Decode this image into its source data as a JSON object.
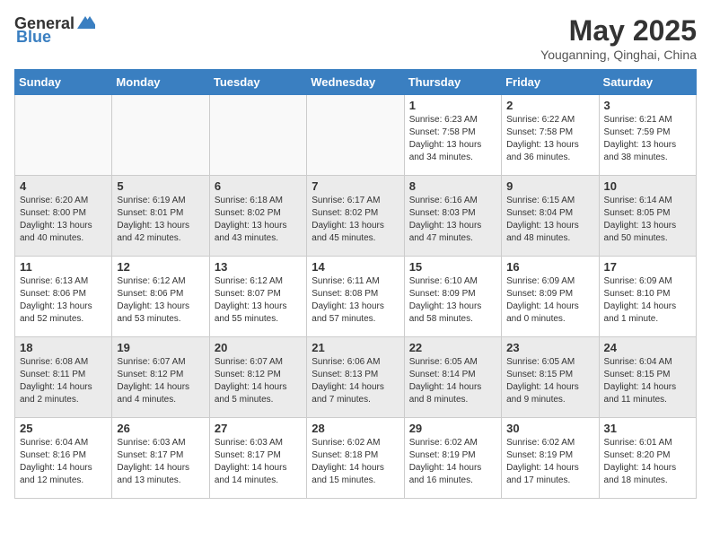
{
  "header": {
    "logo_general": "General",
    "logo_blue": "Blue",
    "month_year": "May 2025",
    "location": "Youganning, Qinghai, China"
  },
  "weekdays": [
    "Sunday",
    "Monday",
    "Tuesday",
    "Wednesday",
    "Thursday",
    "Friday",
    "Saturday"
  ],
  "weeks": [
    [
      {
        "day": "",
        "empty": true
      },
      {
        "day": "",
        "empty": true
      },
      {
        "day": "",
        "empty": true
      },
      {
        "day": "",
        "empty": true
      },
      {
        "day": "1",
        "sunrise": "6:23 AM",
        "sunset": "7:58 PM",
        "daylight": "13 hours and 34 minutes."
      },
      {
        "day": "2",
        "sunrise": "6:22 AM",
        "sunset": "7:58 PM",
        "daylight": "13 hours and 36 minutes."
      },
      {
        "day": "3",
        "sunrise": "6:21 AM",
        "sunset": "7:59 PM",
        "daylight": "13 hours and 38 minutes."
      }
    ],
    [
      {
        "day": "4",
        "sunrise": "6:20 AM",
        "sunset": "8:00 PM",
        "daylight": "13 hours and 40 minutes."
      },
      {
        "day": "5",
        "sunrise": "6:19 AM",
        "sunset": "8:01 PM",
        "daylight": "13 hours and 42 minutes."
      },
      {
        "day": "6",
        "sunrise": "6:18 AM",
        "sunset": "8:02 PM",
        "daylight": "13 hours and 43 minutes."
      },
      {
        "day": "7",
        "sunrise": "6:17 AM",
        "sunset": "8:02 PM",
        "daylight": "13 hours and 45 minutes."
      },
      {
        "day": "8",
        "sunrise": "6:16 AM",
        "sunset": "8:03 PM",
        "daylight": "13 hours and 47 minutes."
      },
      {
        "day": "9",
        "sunrise": "6:15 AM",
        "sunset": "8:04 PM",
        "daylight": "13 hours and 48 minutes."
      },
      {
        "day": "10",
        "sunrise": "6:14 AM",
        "sunset": "8:05 PM",
        "daylight": "13 hours and 50 minutes."
      }
    ],
    [
      {
        "day": "11",
        "sunrise": "6:13 AM",
        "sunset": "8:06 PM",
        "daylight": "13 hours and 52 minutes."
      },
      {
        "day": "12",
        "sunrise": "6:12 AM",
        "sunset": "8:06 PM",
        "daylight": "13 hours and 53 minutes."
      },
      {
        "day": "13",
        "sunrise": "6:12 AM",
        "sunset": "8:07 PM",
        "daylight": "13 hours and 55 minutes."
      },
      {
        "day": "14",
        "sunrise": "6:11 AM",
        "sunset": "8:08 PM",
        "daylight": "13 hours and 57 minutes."
      },
      {
        "day": "15",
        "sunrise": "6:10 AM",
        "sunset": "8:09 PM",
        "daylight": "13 hours and 58 minutes."
      },
      {
        "day": "16",
        "sunrise": "6:09 AM",
        "sunset": "8:09 PM",
        "daylight": "14 hours and 0 minutes."
      },
      {
        "day": "17",
        "sunrise": "6:09 AM",
        "sunset": "8:10 PM",
        "daylight": "14 hours and 1 minute."
      }
    ],
    [
      {
        "day": "18",
        "sunrise": "6:08 AM",
        "sunset": "8:11 PM",
        "daylight": "14 hours and 2 minutes."
      },
      {
        "day": "19",
        "sunrise": "6:07 AM",
        "sunset": "8:12 PM",
        "daylight": "14 hours and 4 minutes."
      },
      {
        "day": "20",
        "sunrise": "6:07 AM",
        "sunset": "8:12 PM",
        "daylight": "14 hours and 5 minutes."
      },
      {
        "day": "21",
        "sunrise": "6:06 AM",
        "sunset": "8:13 PM",
        "daylight": "14 hours and 7 minutes."
      },
      {
        "day": "22",
        "sunrise": "6:05 AM",
        "sunset": "8:14 PM",
        "daylight": "14 hours and 8 minutes."
      },
      {
        "day": "23",
        "sunrise": "6:05 AM",
        "sunset": "8:15 PM",
        "daylight": "14 hours and 9 minutes."
      },
      {
        "day": "24",
        "sunrise": "6:04 AM",
        "sunset": "8:15 PM",
        "daylight": "14 hours and 11 minutes."
      }
    ],
    [
      {
        "day": "25",
        "sunrise": "6:04 AM",
        "sunset": "8:16 PM",
        "daylight": "14 hours and 12 minutes."
      },
      {
        "day": "26",
        "sunrise": "6:03 AM",
        "sunset": "8:17 PM",
        "daylight": "14 hours and 13 minutes."
      },
      {
        "day": "27",
        "sunrise": "6:03 AM",
        "sunset": "8:17 PM",
        "daylight": "14 hours and 14 minutes."
      },
      {
        "day": "28",
        "sunrise": "6:02 AM",
        "sunset": "8:18 PM",
        "daylight": "14 hours and 15 minutes."
      },
      {
        "day": "29",
        "sunrise": "6:02 AM",
        "sunset": "8:19 PM",
        "daylight": "14 hours and 16 minutes."
      },
      {
        "day": "30",
        "sunrise": "6:02 AM",
        "sunset": "8:19 PM",
        "daylight": "14 hours and 17 minutes."
      },
      {
        "day": "31",
        "sunrise": "6:01 AM",
        "sunset": "8:20 PM",
        "daylight": "14 hours and 18 minutes."
      }
    ]
  ]
}
